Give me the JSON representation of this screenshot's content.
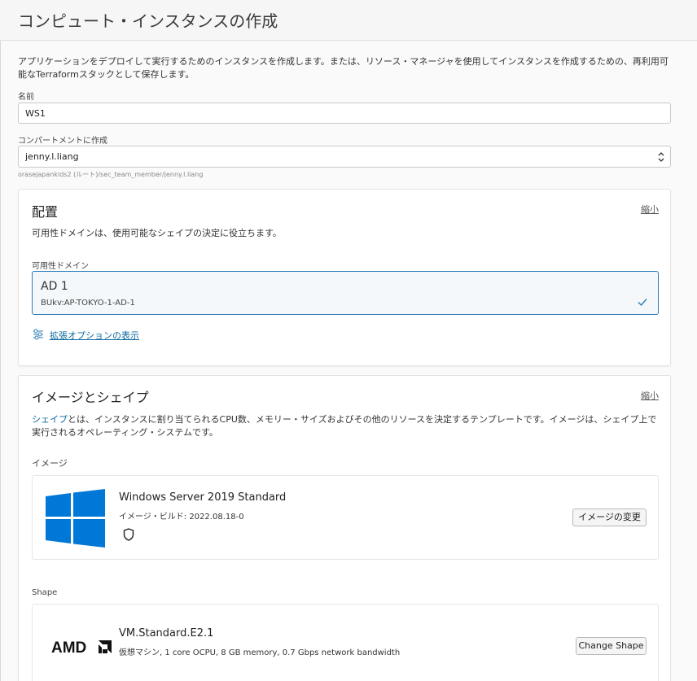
{
  "page": {
    "title": "コンピュート・インスタンスの作成",
    "intro": "アプリケーションをデプロイして実行するためのインスタンスを作成します。または、リソース・マネージャを使用してインスタンスを作成するための、再利用可能なTerraformスタックとして保存します。"
  },
  "name_field": {
    "label": "名前",
    "value": "WS1"
  },
  "compartment": {
    "label": "コンパートメントに作成",
    "value": "jenny.l.liang",
    "path": "orasejapankids2 (ルート)/sec_team_member/jenny.l.liang"
  },
  "placement": {
    "title": "配置",
    "collapse": "縮小",
    "description": "可用性ドメインは、使用可能なシェイプの決定に役立ちます。",
    "ad_label": "可用性ドメイン",
    "ad_name": "AD 1",
    "ad_id": "BUkv:AP-TOKYO-1-AD-1",
    "advanced_link": "拡張オプションの表示"
  },
  "image_shape": {
    "title": "イメージとシェイプ",
    "collapse": "縮小",
    "desc_link": "シェイプ",
    "desc_rest": "とは、インスタンスに割り当てられるCPU数、メモリー・サイズおよびその他のリソースを決定するテンプレートです。イメージは、シェイプ上で実行されるオペレーティング・システムです。",
    "image_label": "イメージ",
    "image_name": "Windows Server 2019 Standard",
    "image_build": "イメージ・ビルド: 2022.08.18-0",
    "change_image": "イメージの変更",
    "shape_label": "Shape",
    "shape_name": "VM.Standard.E2.1",
    "shape_desc": "仮想マシン, 1 core OCPU, 8 GB memory, 0.7 Gbps network bandwidth",
    "change_shape": "Change Shape",
    "amd_logo": "AMD"
  },
  "colors": {
    "accent": "#2c7bb5",
    "link": "#0a6aa1",
    "windows_blue": "#0078d7"
  }
}
